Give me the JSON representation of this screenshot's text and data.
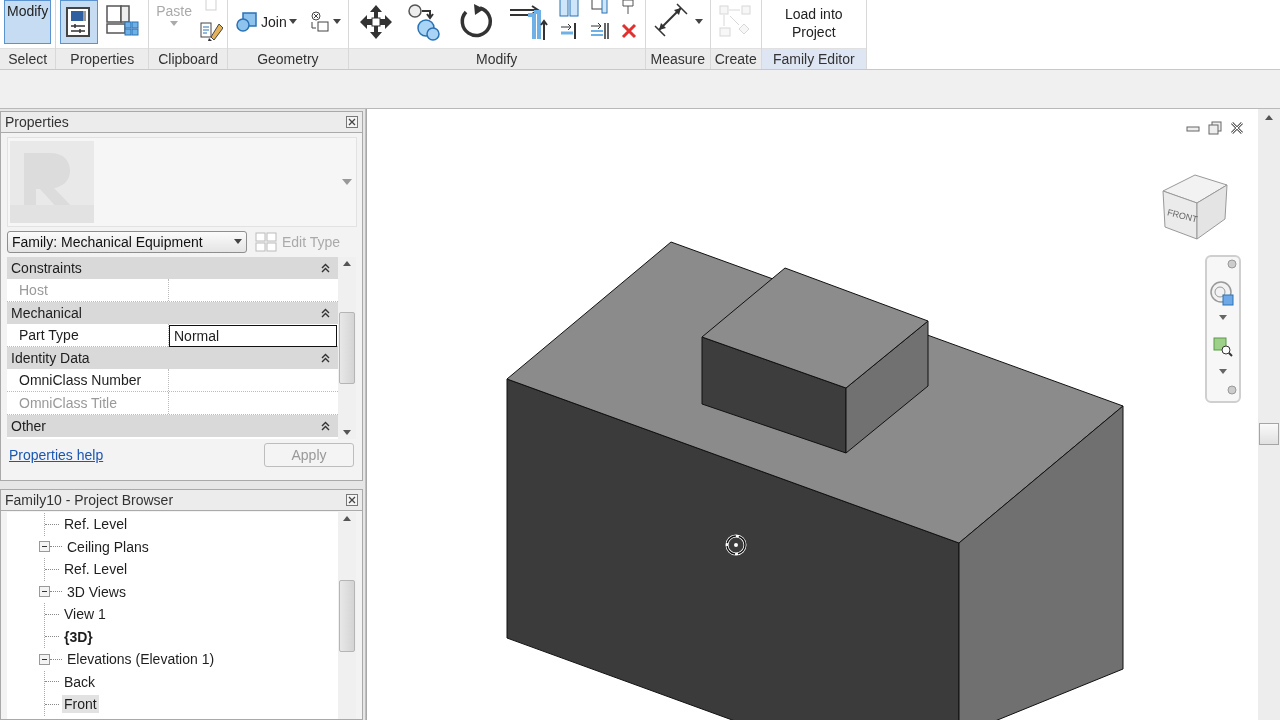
{
  "ribbon": {
    "panels": [
      {
        "label": "Select",
        "contextual": false,
        "tools": [
          {
            "kind": "modify",
            "label": "Modify",
            "selected": true,
            "disabled": false,
            "dropdown": false
          }
        ]
      },
      {
        "label": "Properties",
        "contextual": false,
        "tools": [
          {
            "kind": "properties",
            "selected": true,
            "disabled": false,
            "dropdown": false
          },
          {
            "kind": "types",
            "selected": false,
            "disabled": false,
            "dropdown": false
          }
        ]
      },
      {
        "label": "Clipboard",
        "contextual": false,
        "tools": [
          {
            "kind": "paste",
            "label": "Paste",
            "selected": false,
            "disabled": true,
            "dropdown": true
          }
        ],
        "small_tools": [
          {
            "kind": "copy",
            "selected": false,
            "disabled": true,
            "dropdown": false
          },
          {
            "kind": "match",
            "selected": false,
            "disabled": false,
            "dropdown": false
          }
        ]
      },
      {
        "label": "Geometry",
        "contextual": false,
        "tools": [
          {
            "kind": "join",
            "label": "Join",
            "selected": false,
            "disabled": false,
            "dropdown": true
          },
          {
            "kind": "cut",
            "selected": false,
            "disabled": false,
            "dropdown": true
          }
        ]
      },
      {
        "label": "Modify",
        "contextual": false,
        "tools": [
          {
            "kind": "move",
            "selected": false,
            "disabled": false,
            "dropdown": false
          },
          {
            "kind": "duplicate",
            "selected": false,
            "disabled": false,
            "dropdown": false
          },
          {
            "kind": "rotate",
            "selected": false,
            "disabled": false,
            "dropdown": false
          },
          {
            "kind": "trim",
            "selected": false,
            "disabled": false,
            "dropdown": false
          }
        ],
        "small_tools": [
          {
            "kind": "array",
            "selected": false,
            "disabled": false,
            "dropdown": false
          },
          {
            "kind": "split",
            "selected": false,
            "disabled": false,
            "dropdown": false
          },
          {
            "kind": "scale",
            "selected": false,
            "disabled": false,
            "dropdown": false
          },
          {
            "kind": "splitgap",
            "selected": false,
            "disabled": false,
            "dropdown": false
          },
          {
            "kind": "pin",
            "selected": false,
            "disabled": false,
            "dropdown": false
          },
          {
            "kind": "delete",
            "selected": false,
            "disabled": false,
            "dropdown": false
          }
        ]
      },
      {
        "label": "Measure",
        "contextual": false,
        "tools": [
          {
            "kind": "measure",
            "selected": false,
            "disabled": false,
            "dropdown": true
          }
        ]
      },
      {
        "label": "Create",
        "contextual": false,
        "tools": [
          {
            "kind": "create",
            "selected": false,
            "disabled": true,
            "dropdown": false
          }
        ]
      },
      {
        "label": "Family Editor",
        "contextual": true,
        "tools": [
          {
            "kind": "load",
            "label": "Load into Project",
            "selected": false,
            "disabled": false,
            "dropdown": false
          }
        ]
      }
    ]
  },
  "properties": {
    "title": "Properties",
    "type_selector": "Family: Mechanical Equipment",
    "edit_type": {
      "label": "Edit Type",
      "disabled": true
    },
    "groups": [
      {
        "label": "Constraints",
        "rows": [
          {
            "name": "Host",
            "value": "",
            "disabled": true,
            "editing": false
          }
        ]
      },
      {
        "label": "Mechanical",
        "rows": [
          {
            "name": "Part Type",
            "value": "Normal",
            "disabled": false,
            "editing": true
          }
        ]
      },
      {
        "label": "Identity Data",
        "rows": [
          {
            "name": "OmniClass Number",
            "value": "",
            "disabled": false,
            "editing": false
          },
          {
            "name": "OmniClass Title",
            "value": "",
            "disabled": true,
            "editing": false
          }
        ]
      },
      {
        "label": "Other"
      }
    ],
    "help_link": "Properties help",
    "apply": {
      "label": "Apply",
      "disabled": true
    }
  },
  "project_browser": {
    "title": "Family10 - Project Browser",
    "items": [
      {
        "children": [
          {
            "label": "Ref. Level",
            "selected": false,
            "current": false
          }
        ]
      },
      {
        "label": "Ceiling Plans",
        "expanded": true,
        "selected": false,
        "current": false,
        "children": [
          {
            "label": "Ref. Level",
            "selected": false,
            "current": false
          }
        ]
      },
      {
        "label": "3D Views",
        "expanded": true,
        "selected": false,
        "current": false,
        "children": [
          {
            "label": "View 1",
            "selected": false,
            "current": false
          },
          {
            "label": "{3D}",
            "selected": false,
            "current": true
          }
        ]
      },
      {
        "label": "Elevations (Elevation 1)",
        "expanded": true,
        "selected": false,
        "current": false,
        "children": [
          {
            "label": "Back",
            "selected": false,
            "current": false
          },
          {
            "label": "Front",
            "selected": true,
            "current": false
          }
        ]
      }
    ]
  },
  "view": {
    "view_cube": {
      "face": "FRONT"
    }
  }
}
